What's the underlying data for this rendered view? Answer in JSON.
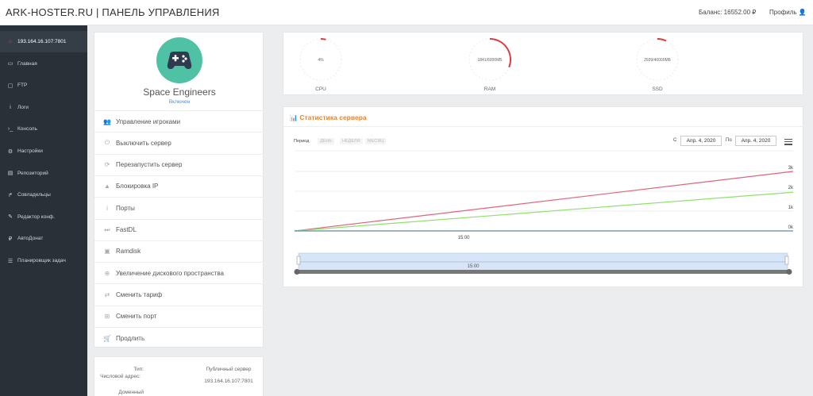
{
  "header": {
    "brand": "ARK-HOSTER.RU | ПАНЕЛЬ УПРАВЛЕНИЯ",
    "balance": "Баланс: 16552.00 ₽",
    "profile": "Профиль 👤"
  },
  "sidebar": {
    "items": [
      {
        "label": "193.164.16.107:7801",
        "icon": "home-icon",
        "glyph": "⌂"
      },
      {
        "label": "Главная",
        "icon": "monitor-icon",
        "glyph": "▭"
      },
      {
        "label": "FTP",
        "icon": "folder-icon",
        "glyph": "▢"
      },
      {
        "label": "Логи",
        "icon": "info-icon",
        "glyph": "i"
      },
      {
        "label": "Консоль",
        "icon": "terminal-icon",
        "glyph": "›_"
      },
      {
        "label": "Настройки",
        "icon": "cogs-icon",
        "glyph": "⚙"
      },
      {
        "label": "Репозиторий",
        "icon": "archive-icon",
        "glyph": "▤"
      },
      {
        "label": "Совладельцы",
        "icon": "share-icon",
        "glyph": "↱"
      },
      {
        "label": "Редактор конф.",
        "icon": "edit-icon",
        "glyph": "✎"
      },
      {
        "label": "АвтоДонат",
        "icon": "ruble-icon",
        "glyph": "₽"
      },
      {
        "label": "Планировщик задач",
        "icon": "list-icon",
        "glyph": "☰"
      }
    ]
  },
  "server": {
    "name": "Space Engineers",
    "status": "Включен"
  },
  "menu": {
    "items": [
      {
        "label": "Управление игроками",
        "icon": "users-icon",
        "glyph": "👥"
      },
      {
        "label": "Выключить сервер",
        "icon": "power-icon",
        "glyph": "⏻"
      },
      {
        "label": "Перезапустить сервер",
        "icon": "refresh-icon",
        "glyph": "⟳"
      },
      {
        "label": "Блокировка IP",
        "icon": "warning-icon",
        "glyph": "▲"
      },
      {
        "label": "Порты",
        "icon": "info-icon",
        "glyph": "i"
      },
      {
        "label": "FastDL",
        "icon": "fast-forward-icon",
        "glyph": "⏭"
      },
      {
        "label": "Ramdisk",
        "icon": "floppy-icon",
        "glyph": "▣"
      },
      {
        "label": "Увеличение дискового пространства",
        "icon": "plus-circle-icon",
        "glyph": "⊕"
      },
      {
        "label": "Сменить тариф",
        "icon": "exchange-icon",
        "glyph": "⇄"
      },
      {
        "label": "Сменить порт",
        "icon": "plus-square-icon",
        "glyph": "⊞"
      },
      {
        "label": "Продлить",
        "icon": "cart-icon",
        "glyph": "🛒"
      }
    ]
  },
  "info": {
    "rows": [
      {
        "key": "Тип:",
        "value": "Публичный сервер"
      },
      {
        "key": "Числовой адрес:",
        "value": "193.164.16.107:7801"
      },
      {
        "key": "Доменный",
        "value": ""
      }
    ]
  },
  "gauges": [
    {
      "label": "CPU",
      "value": "4%",
      "fraction": 0.04,
      "color": "#e0383d"
    },
    {
      "label": "RAM",
      "value": "1841/6000МБ",
      "fraction": 0.31,
      "color": "#e0383d"
    },
    {
      "label": "SSD",
      "value": "2939/40000МБ",
      "fraction": 0.07,
      "color": "#e0383d"
    }
  ],
  "stats": {
    "title": "Статистика сервера",
    "period_label": "Период",
    "period_options": [
      "ДЕНЬ",
      "НЕДЕЛЯ",
      "МЕСЯЦ"
    ],
    "from_label": "С",
    "from_date": "Апр. 4, 2020",
    "to_label": "По",
    "to_date": "Апр. 4, 2020"
  },
  "chart_data": {
    "type": "line",
    "x": [
      "start",
      "end"
    ],
    "xticks": [
      "15:00"
    ],
    "navigator_tick": "15:00",
    "yticks": [
      "0k",
      "1k",
      "2k",
      "3k"
    ],
    "ylim": [
      0,
      3000
    ],
    "series": [
      {
        "values": [
          0,
          3000
        ],
        "color": "#e0647c"
      },
      {
        "values": [
          0,
          1950
        ],
        "color": "#90e06c"
      },
      {
        "values": [
          0,
          0
        ],
        "color": "#5a8fa0"
      }
    ],
    "grid": true
  }
}
